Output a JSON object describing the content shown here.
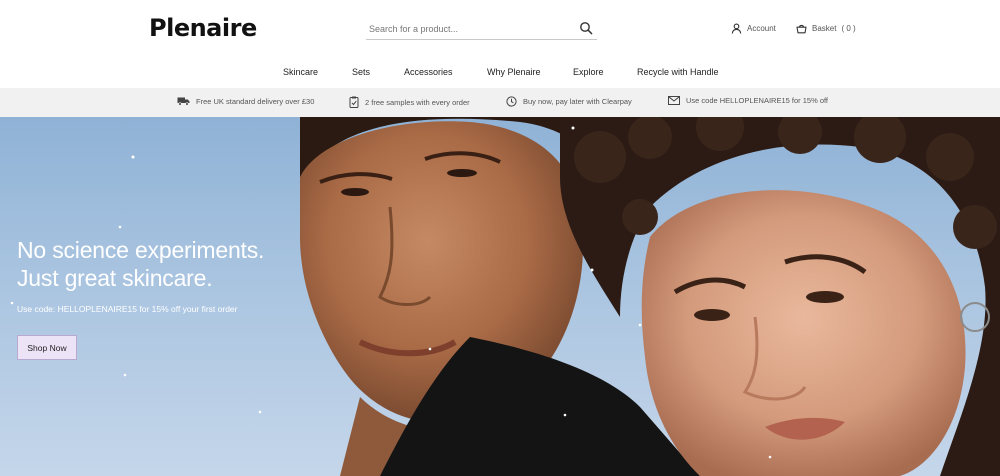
{
  "header": {
    "logo": "Plenaire",
    "search": {
      "placeholder": "Search for a product..."
    },
    "account_label": "Account",
    "basket_label": "Basket",
    "basket_count": "( 0 )"
  },
  "nav": {
    "items": [
      {
        "label": "Skincare"
      },
      {
        "label": "Sets"
      },
      {
        "label": "Accessories"
      },
      {
        "label": "Why Plenaire"
      },
      {
        "label": "Explore"
      },
      {
        "label": "Recycle with Handle"
      }
    ]
  },
  "benefits": [
    {
      "icon": "delivery-truck-icon",
      "text": "Free UK standard delivery over £30"
    },
    {
      "icon": "clipboard-check-icon",
      "text": "2 free samples with every order"
    },
    {
      "icon": "clock-icon",
      "text": "Buy now, pay later with Clearpay"
    },
    {
      "icon": "envelope-icon",
      "text": "Use code HELLOPLENAIRE15 for 15% off"
    }
  ],
  "hero": {
    "headline_line1": "No science experiments.",
    "headline_line2": "Just great skincare.",
    "subtext": "Use code: HELLOPLENAIRE15 for 15% off your first order",
    "cta_label": "Shop Now"
  },
  "colors": {
    "sky": "#a9c4e0",
    "strip_bg": "#f1f1f1",
    "cta_bg": "#ece3f6",
    "cta_border": "#b9a9d0"
  }
}
